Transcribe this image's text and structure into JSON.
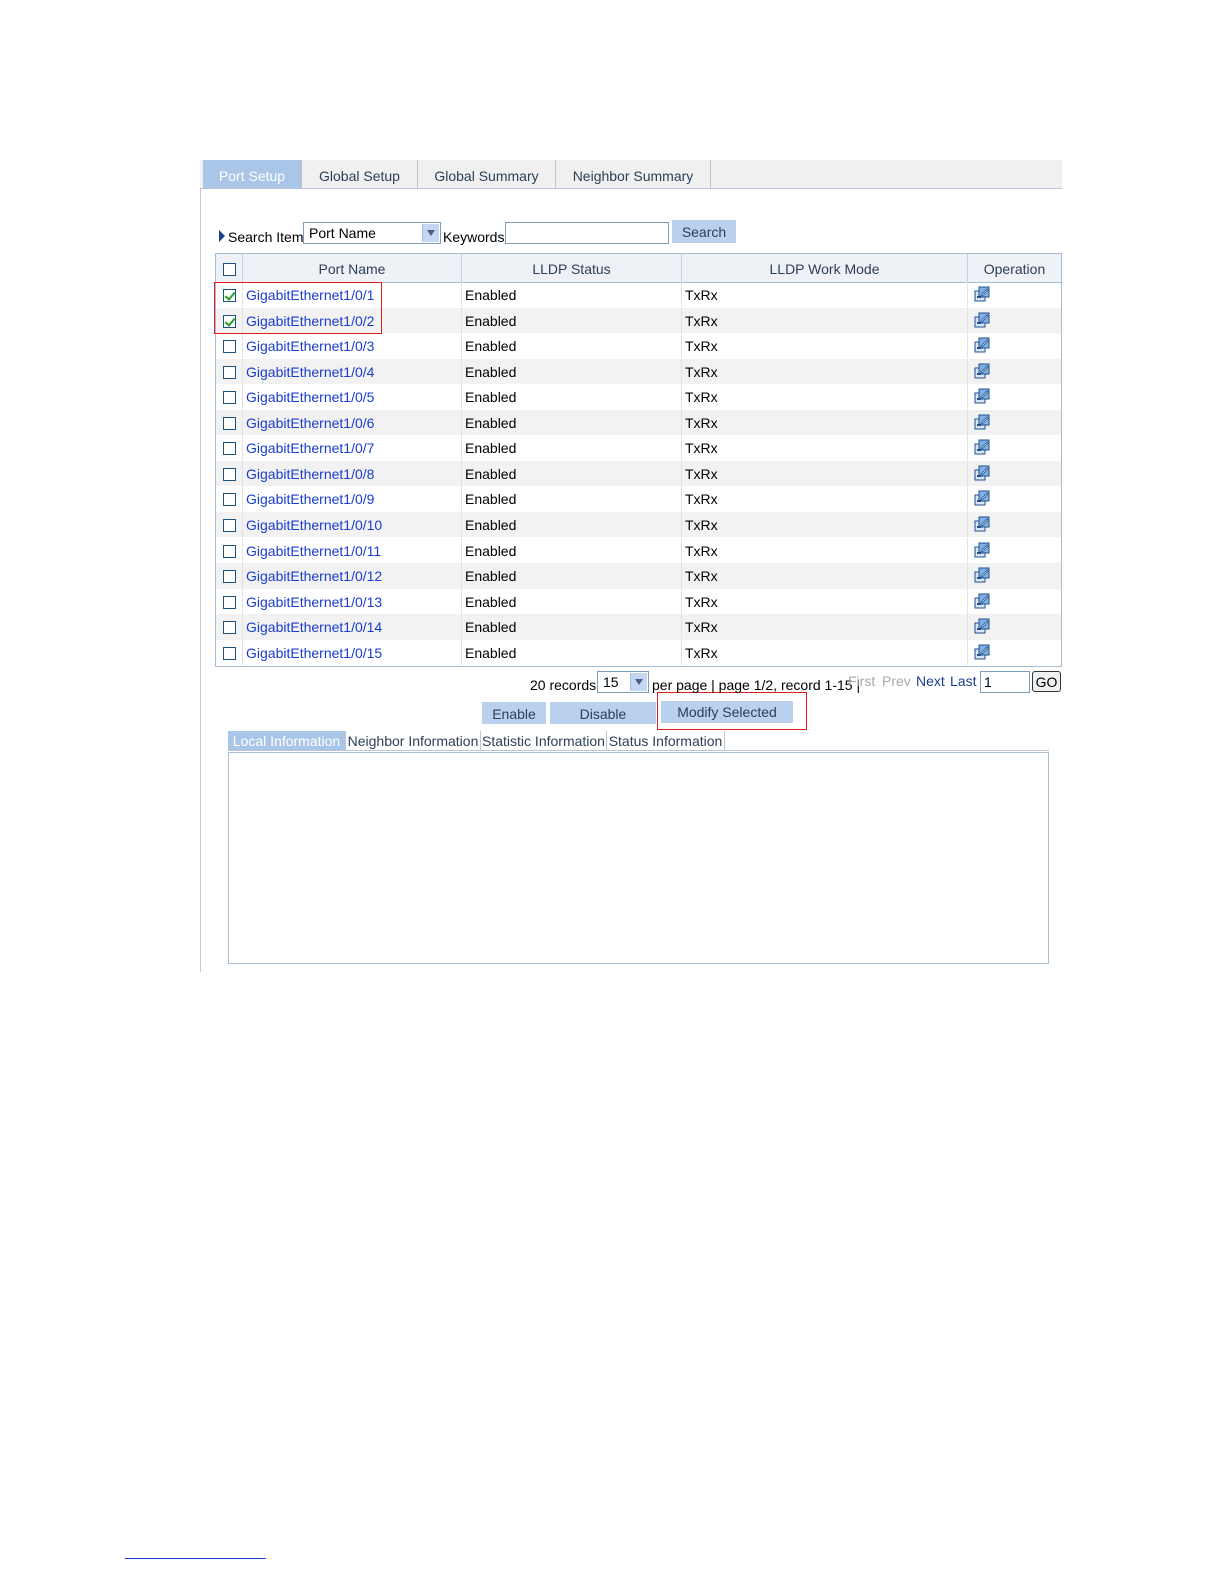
{
  "tabs": [
    {
      "label": "Port Setup",
      "active": true
    },
    {
      "label": "Global Setup",
      "active": false
    },
    {
      "label": "Global Summary",
      "active": false
    },
    {
      "label": "Neighbor Summary",
      "active": false
    }
  ],
  "search": {
    "item_label": "Search Item:",
    "item_value": "Port Name",
    "keywords_label": "Keywords:",
    "keywords_value": "",
    "button_label": "Search"
  },
  "table": {
    "columns": [
      "Port Name",
      "LLDP Status",
      "LLDP Work Mode",
      "Operation"
    ],
    "rows": [
      {
        "port": "GigabitEthernet1/0/1",
        "status": "Enabled",
        "mode": "TxRx",
        "checked": true
      },
      {
        "port": "GigabitEthernet1/0/2",
        "status": "Enabled",
        "mode": "TxRx",
        "checked": true
      },
      {
        "port": "GigabitEthernet1/0/3",
        "status": "Enabled",
        "mode": "TxRx",
        "checked": false
      },
      {
        "port": "GigabitEthernet1/0/4",
        "status": "Enabled",
        "mode": "TxRx",
        "checked": false
      },
      {
        "port": "GigabitEthernet1/0/5",
        "status": "Enabled",
        "mode": "TxRx",
        "checked": false
      },
      {
        "port": "GigabitEthernet1/0/6",
        "status": "Enabled",
        "mode": "TxRx",
        "checked": false
      },
      {
        "port": "GigabitEthernet1/0/7",
        "status": "Enabled",
        "mode": "TxRx",
        "checked": false
      },
      {
        "port": "GigabitEthernet1/0/8",
        "status": "Enabled",
        "mode": "TxRx",
        "checked": false
      },
      {
        "port": "GigabitEthernet1/0/9",
        "status": "Enabled",
        "mode": "TxRx",
        "checked": false
      },
      {
        "port": "GigabitEthernet1/0/10",
        "status": "Enabled",
        "mode": "TxRx",
        "checked": false
      },
      {
        "port": "GigabitEthernet1/0/11",
        "status": "Enabled",
        "mode": "TxRx",
        "checked": false
      },
      {
        "port": "GigabitEthernet1/0/12",
        "status": "Enabled",
        "mode": "TxRx",
        "checked": false
      },
      {
        "port": "GigabitEthernet1/0/13",
        "status": "Enabled",
        "mode": "TxRx",
        "checked": false
      },
      {
        "port": "GigabitEthernet1/0/14",
        "status": "Enabled",
        "mode": "TxRx",
        "checked": false
      },
      {
        "port": "GigabitEthernet1/0/15",
        "status": "Enabled",
        "mode": "TxRx",
        "checked": false
      }
    ],
    "operation_icon": "modify-icon"
  },
  "pager": {
    "records_text": "20 records,",
    "per_page_value": "15",
    "info_text": "per page | page 1/2, record 1-15 |",
    "first": "First",
    "prev": "Prev",
    "next": "Next",
    "last": "Last",
    "page_input": "1",
    "go": "GO"
  },
  "actions": {
    "enable": "Enable",
    "disable": "Disable",
    "modify": "Modify Selected"
  },
  "info_tabs": [
    {
      "label": "Local Information",
      "active": true
    },
    {
      "label": "Neighbor Information",
      "active": false
    },
    {
      "label": "Statistic Information",
      "active": false
    },
    {
      "label": "Status Information",
      "active": false
    }
  ],
  "colors": {
    "tab_active": "#a9c5e8",
    "link": "#1a3ccf",
    "highlight": "#e01c1c",
    "check": "#21a121"
  }
}
